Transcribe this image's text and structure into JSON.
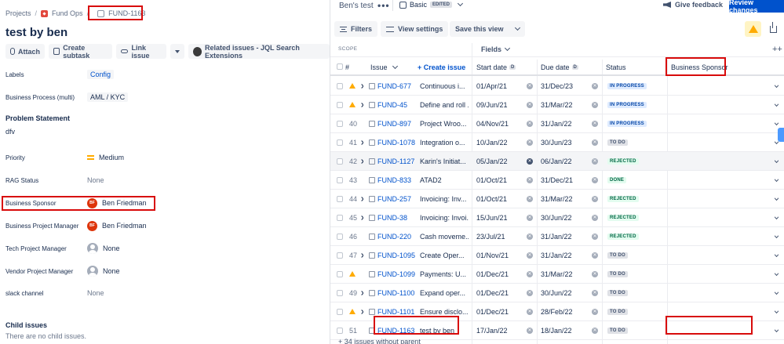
{
  "left": {
    "breadcrumbs": {
      "projects": "Projects",
      "project": "Fund Ops",
      "issue_key": "FUND-1163"
    },
    "title": "test by ben",
    "actions": {
      "attach": "Attach",
      "create_subtask": "Create subtask",
      "link_issue": "Link issue",
      "related": "Related issues - JQL Search Extensions"
    },
    "fields": {
      "labels_label": "Labels",
      "labels_value": "Config",
      "bp_label": "Business Process (multi)",
      "bp_value": "AML / KYC",
      "problem_title": "Problem Statement",
      "problem_text": "dfv",
      "priority_label": "Priority",
      "priority_value": "Medium",
      "rag_label": "RAG Status",
      "rag_value": "None",
      "sponsor_label": "Business Sponsor",
      "sponsor_value": "Ben Friedman",
      "bpm_label": "Business Project Manager",
      "bpm_value": "Ben Friedman",
      "tpm_label": "Tech Project Manager",
      "tpm_value": "None",
      "vpm_label": "Vendor Project Manager",
      "vpm_value": "None",
      "slack_label": "slack channel",
      "slack_value": "None",
      "avatar_initials": "BF"
    },
    "child": {
      "title": "Child issues",
      "empty": "There are no child issues."
    }
  },
  "right": {
    "view_name": "Ben's test",
    "view_type": "Basic",
    "edited": "EDITED",
    "give_feedback": "Give feedback",
    "review_changes": "Review changes",
    "filters": "Filters",
    "view_settings": "View settings",
    "save_view": "Save this view",
    "scope": "SCOPE",
    "fields": "Fields",
    "columns": {
      "num": "#",
      "issue": "Issue",
      "create_issue": "+ Create issue",
      "start": "Start date",
      "due": "Due date",
      "date_badge": "D",
      "status": "Status",
      "sponsor": "Business Sponsor"
    },
    "rows": [
      {
        "num": "",
        "warn": true,
        "expand": true,
        "key": "FUND-677",
        "summary": "Continuous i...",
        "start": "01/Apr/21",
        "due": "31/Dec/23",
        "status": "IN PROGRESS",
        "stype": "inprog"
      },
      {
        "num": "",
        "warn": true,
        "expand": true,
        "key": "FUND-45",
        "summary": "Define and roll ...",
        "start": "09/Jun/21",
        "due": "31/Mar/22",
        "status": "IN PROGRESS",
        "stype": "inprog"
      },
      {
        "num": "40",
        "warn": false,
        "expand": false,
        "key": "FUND-897",
        "summary": "Project Wroo...",
        "start": "04/Nov/21",
        "due": "31/Jan/22",
        "status": "IN PROGRESS",
        "stype": "inprog"
      },
      {
        "num": "41",
        "warn": false,
        "expand": true,
        "key": "FUND-1078",
        "summary": "Integration o...",
        "start": "10/Jan/22",
        "due": "30/Jun/23",
        "status": "TO DO",
        "stype": "todo"
      },
      {
        "num": "42",
        "warn": false,
        "expand": true,
        "key": "FUND-1127",
        "summary": "Karin's Initiat...",
        "start": "05/Jan/22",
        "due": "06/Jan/22",
        "status": "REJECTED",
        "stype": "rej"
      },
      {
        "num": "43",
        "warn": false,
        "expand": false,
        "key": "FUND-833",
        "summary": "ATAD2",
        "start": "01/Oct/21",
        "due": "31/Dec/21",
        "status": "DONE",
        "stype": "done"
      },
      {
        "num": "44",
        "warn": false,
        "expand": true,
        "key": "FUND-257",
        "summary": "Invoicing: Inv...",
        "start": "01/Oct/21",
        "due": "31/Mar/22",
        "status": "REJECTED",
        "stype": "rej"
      },
      {
        "num": "45",
        "warn": false,
        "expand": true,
        "key": "FUND-38",
        "summary": "Invoicing: Invoi...",
        "start": "15/Jun/21",
        "due": "30/Jun/22",
        "status": "REJECTED",
        "stype": "rej"
      },
      {
        "num": "46",
        "warn": false,
        "expand": false,
        "key": "FUND-220",
        "summary": "Cash moveme...",
        "start": "23/Jul/21",
        "due": "31/Jan/22",
        "status": "REJECTED",
        "stype": "rej"
      },
      {
        "num": "47",
        "warn": false,
        "expand": true,
        "key": "FUND-1095",
        "summary": "Create Oper...",
        "start": "01/Nov/21",
        "due": "31/Jan/22",
        "status": "TO DO",
        "stype": "todo"
      },
      {
        "num": "",
        "warn": true,
        "expand": false,
        "key": "FUND-1099",
        "summary": "Payments: U...",
        "start": "01/Dec/21",
        "due": "31/Mar/22",
        "status": "TO DO",
        "stype": "todo"
      },
      {
        "num": "49",
        "warn": false,
        "expand": true,
        "key": "FUND-1100",
        "summary": "Expand oper...",
        "start": "01/Dec/21",
        "due": "30/Jun/22",
        "status": "TO DO",
        "stype": "todo"
      },
      {
        "num": "",
        "warn": true,
        "expand": true,
        "key": "FUND-1101",
        "summary": "Ensure disclo...",
        "start": "01/Dec/21",
        "due": "28/Feb/22",
        "status": "TO DO",
        "stype": "todo"
      },
      {
        "num": "51",
        "warn": false,
        "expand": false,
        "key": "FUND-1163",
        "summary": "test by ben",
        "start": "17/Jan/22",
        "due": "18/Jan/22",
        "status": "TO DO",
        "stype": "todo"
      }
    ],
    "footer": "+ 34 issues without parent"
  },
  "colors": {
    "highlight": "#d80b0b",
    "link": "#0052cc",
    "primary": "#0052cc",
    "warning": "#ffab00"
  }
}
